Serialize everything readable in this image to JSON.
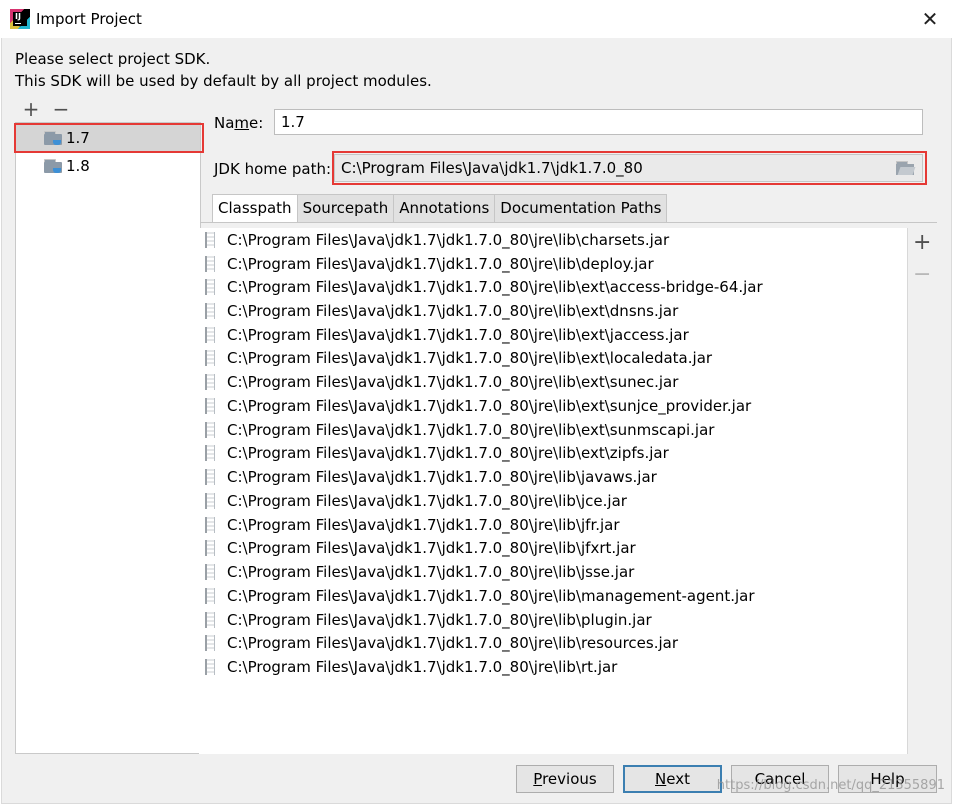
{
  "window": {
    "title": "Import Project"
  },
  "description": {
    "line1": "Please select project SDK.",
    "line2": "This SDK will be used by default by all project modules."
  },
  "sdk_toolbar": {
    "add": "+",
    "remove": "−"
  },
  "sdks": [
    {
      "label": "1.7",
      "selected": true
    },
    {
      "label": "1.8",
      "selected": false
    }
  ],
  "name_field": {
    "label_pre": "Na",
    "label_mnemonic": "m",
    "label_post": "e:",
    "value": "1.7"
  },
  "jdk_home": {
    "label": "JDK home path:",
    "value": "C:\\Program Files\\Java\\jdk1.7\\jdk1.7.0_80"
  },
  "tabs": [
    {
      "label": "Classpath",
      "active": true
    },
    {
      "label": "Sourcepath",
      "active": false
    },
    {
      "label": "Annotations",
      "active": false
    },
    {
      "label": "Documentation Paths",
      "active": false
    }
  ],
  "classpath": [
    "C:\\Program Files\\Java\\jdk1.7\\jdk1.7.0_80\\jre\\lib\\charsets.jar",
    "C:\\Program Files\\Java\\jdk1.7\\jdk1.7.0_80\\jre\\lib\\deploy.jar",
    "C:\\Program Files\\Java\\jdk1.7\\jdk1.7.0_80\\jre\\lib\\ext\\access-bridge-64.jar",
    "C:\\Program Files\\Java\\jdk1.7\\jdk1.7.0_80\\jre\\lib\\ext\\dnsns.jar",
    "C:\\Program Files\\Java\\jdk1.7\\jdk1.7.0_80\\jre\\lib\\ext\\jaccess.jar",
    "C:\\Program Files\\Java\\jdk1.7\\jdk1.7.0_80\\jre\\lib\\ext\\localedata.jar",
    "C:\\Program Files\\Java\\jdk1.7\\jdk1.7.0_80\\jre\\lib\\ext\\sunec.jar",
    "C:\\Program Files\\Java\\jdk1.7\\jdk1.7.0_80\\jre\\lib\\ext\\sunjce_provider.jar",
    "C:\\Program Files\\Java\\jdk1.7\\jdk1.7.0_80\\jre\\lib\\ext\\sunmscapi.jar",
    "C:\\Program Files\\Java\\jdk1.7\\jdk1.7.0_80\\jre\\lib\\ext\\zipfs.jar",
    "C:\\Program Files\\Java\\jdk1.7\\jdk1.7.0_80\\jre\\lib\\javaws.jar",
    "C:\\Program Files\\Java\\jdk1.7\\jdk1.7.0_80\\jre\\lib\\jce.jar",
    "C:\\Program Files\\Java\\jdk1.7\\jdk1.7.0_80\\jre\\lib\\jfr.jar",
    "C:\\Program Files\\Java\\jdk1.7\\jdk1.7.0_80\\jre\\lib\\jfxrt.jar",
    "C:\\Program Files\\Java\\jdk1.7\\jdk1.7.0_80\\jre\\lib\\jsse.jar",
    "C:\\Program Files\\Java\\jdk1.7\\jdk1.7.0_80\\jre\\lib\\management-agent.jar",
    "C:\\Program Files\\Java\\jdk1.7\\jdk1.7.0_80\\jre\\lib\\plugin.jar",
    "C:\\Program Files\\Java\\jdk1.7\\jdk1.7.0_80\\jre\\lib\\resources.jar",
    "C:\\Program Files\\Java\\jdk1.7\\jdk1.7.0_80\\jre\\lib\\rt.jar"
  ],
  "path_toolbar": {
    "add": "+",
    "remove": "−"
  },
  "buttons": {
    "previous": {
      "mnemonic": "P",
      "rest": "revious"
    },
    "next": {
      "mnemonic": "N",
      "rest": "ext"
    },
    "cancel": {
      "label": "Cancel"
    },
    "help": {
      "label": "Help"
    }
  },
  "watermark": "https://blog.csdn.net/qq_21355891",
  "icons": {
    "app": "intellij-idea-icon",
    "close": "close-icon",
    "sdk": "jdk-folder-icon",
    "browse": "folder-browse-icon",
    "jar": "jar-file-icon"
  },
  "colors": {
    "highlight": "#e53935",
    "selection": "#d5d5d5",
    "primary_border": "#3c7fb1"
  }
}
